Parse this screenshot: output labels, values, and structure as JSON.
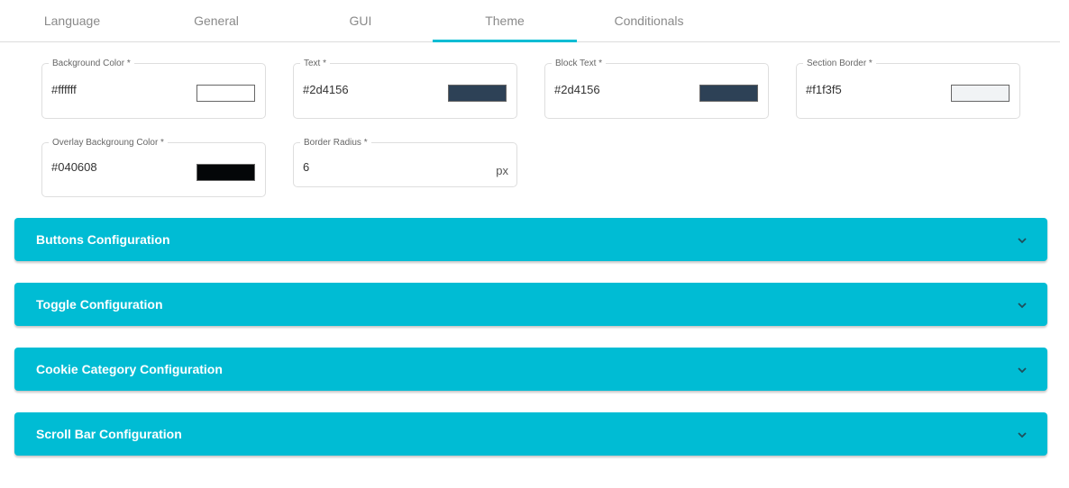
{
  "tabs": [
    {
      "label": "Language",
      "active": false
    },
    {
      "label": "General",
      "active": false
    },
    {
      "label": "GUI",
      "active": false
    },
    {
      "label": "Theme",
      "active": true
    },
    {
      "label": "Conditionals",
      "active": false
    }
  ],
  "fields": {
    "background_color": {
      "label": "Background Color *",
      "value": "#ffffff",
      "swatch": "#ffffff"
    },
    "text": {
      "label": "Text *",
      "value": "#2d4156",
      "swatch": "#2d4156"
    },
    "block_text": {
      "label": "Block Text *",
      "value": "#2d4156",
      "swatch": "#2d4156"
    },
    "section_border": {
      "label": "Section Border *",
      "value": "#f1f3f5",
      "swatch": "#f1f3f5"
    },
    "overlay_background_color": {
      "label": "Overlay Backgroung Color *",
      "value": "#040608",
      "swatch": "#040608"
    },
    "border_radius": {
      "label": "Border Radius *",
      "value": "6",
      "suffix": "px"
    }
  },
  "panels": [
    {
      "title": "Buttons Configuration",
      "icon": "chevron-down-icon"
    },
    {
      "title": "Toggle Configuration",
      "icon": "chevron-down-icon"
    },
    {
      "title": "Cookie Category Configuration",
      "icon": "chevron-down-icon"
    },
    {
      "title": "Scroll Bar Configuration",
      "icon": "chevron-down-icon"
    }
  ],
  "colors": {
    "accent": "#00bcd4",
    "panel_text": "#ffffff",
    "chevron": "#1f4e5a"
  }
}
